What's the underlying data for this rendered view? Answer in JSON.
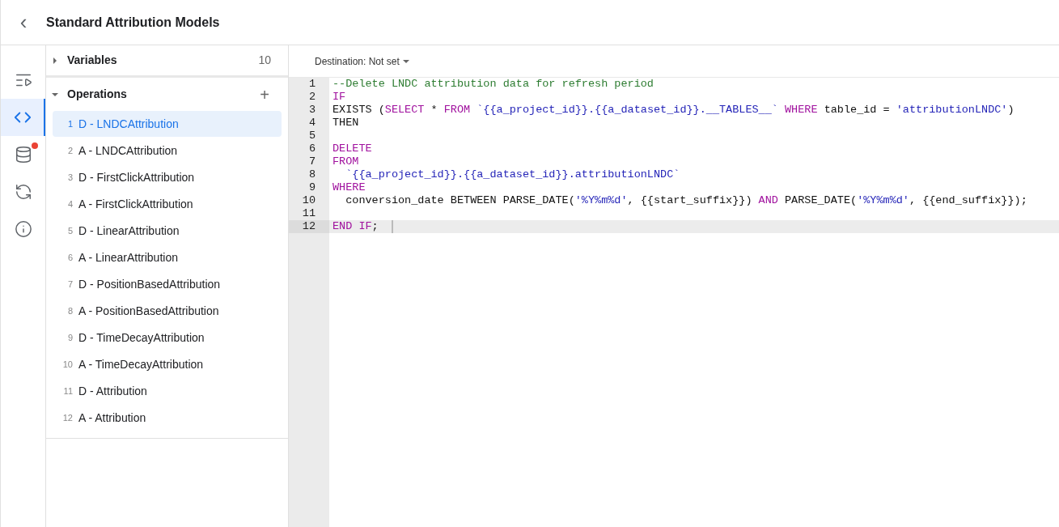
{
  "header": {
    "back": "‹",
    "title": "Standard Attribution Models"
  },
  "rail": [
    {
      "kind": "list",
      "selected": false,
      "badge": false
    },
    {
      "kind": "code",
      "selected": true,
      "badge": false
    },
    {
      "kind": "database",
      "selected": false,
      "badge": true
    },
    {
      "kind": "replay",
      "selected": false,
      "badge": false
    },
    {
      "kind": "info",
      "selected": false,
      "badge": false
    }
  ],
  "variables": {
    "label": "Variables",
    "count": "10",
    "expanded": false
  },
  "operations": {
    "label": "Operations",
    "add": "+",
    "expanded": true,
    "items": [
      {
        "number": "1",
        "label": "D - LNDCAttribution",
        "selected": true
      },
      {
        "number": "2",
        "label": "A - LNDCAttribution",
        "selected": false
      },
      {
        "number": "3",
        "label": "D - FirstClickAttribution",
        "selected": false
      },
      {
        "number": "4",
        "label": "A - FirstClickAttribution",
        "selected": false
      },
      {
        "number": "5",
        "label": "D - LinearAttribution",
        "selected": false
      },
      {
        "number": "6",
        "label": "A - LinearAttribution",
        "selected": false
      },
      {
        "number": "7",
        "label": "D - PositionBasedAttribution",
        "selected": false
      },
      {
        "number": "8",
        "label": "A - PositionBasedAttribution",
        "selected": false
      },
      {
        "number": "9",
        "label": "D - TimeDecayAttribution",
        "selected": false
      },
      {
        "number": "10",
        "label": "A - TimeDecayAttribution",
        "selected": false
      },
      {
        "number": "11",
        "label": "D - Attribution",
        "selected": false
      },
      {
        "number": "12",
        "label": "A - Attribution",
        "selected": false
      }
    ]
  },
  "destination": "Destination: Not set",
  "code_lines": [
    {
      "number": "1",
      "selected": false,
      "tokens": [
        {
          "kind": "comment",
          "text": "--Delete LNDC attribution data for refresh period"
        }
      ]
    },
    {
      "number": "2",
      "selected": false,
      "tokens": [
        {
          "kind": "keyword",
          "text": "IF"
        }
      ]
    },
    {
      "number": "3",
      "selected": false,
      "tokens": [
        {
          "kind": "plain",
          "text": "EXISTS ("
        },
        {
          "kind": "keyword",
          "text": "SELECT"
        },
        {
          "kind": "plain",
          "text": " * "
        },
        {
          "kind": "keyword",
          "text": "FROM "
        },
        {
          "kind": "string",
          "text": "`{{a_project_id}}.{{a_dataset_id}}.__TABLES__`"
        },
        {
          "kind": "keyword",
          "text": " WHERE"
        },
        {
          "kind": "plain",
          "text": " table_id = "
        },
        {
          "kind": "string",
          "text": "'attributionLNDC'"
        },
        {
          "kind": "plain",
          "text": ")"
        }
      ]
    },
    {
      "number": "4",
      "selected": false,
      "tokens": [
        {
          "kind": "plain",
          "text": "THEN"
        }
      ]
    },
    {
      "number": "5",
      "selected": false
    },
    {
      "number": "6",
      "selected": false,
      "tokens": [
        {
          "kind": "keyword",
          "text": "DELETE"
        }
      ]
    },
    {
      "number": "7",
      "selected": false,
      "tokens": [
        {
          "kind": "keyword",
          "text": "FROM"
        }
      ]
    },
    {
      "number": "8",
      "selected": false,
      "tokens": [
        {
          "kind": "string",
          "text": "  `{{a_project_id}}.{{a_dataset_id}}.attributionLNDC`"
        }
      ]
    },
    {
      "number": "9",
      "selected": false,
      "tokens": [
        {
          "kind": "keyword",
          "text": "WHERE"
        }
      ]
    },
    {
      "number": "10",
      "selected": false,
      "tokens": [
        {
          "kind": "plain",
          "text": "  conversion_date BETWEEN PARSE_DATE("
        },
        {
          "kind": "string",
          "text": "'%Y%m%d'"
        },
        {
          "kind": "plain",
          "text": ", {{start_suffix}}) "
        },
        {
          "kind": "keyword",
          "text": "AND"
        },
        {
          "kind": "plain",
          "text": " PARSE_DATE("
        },
        {
          "kind": "string",
          "text": "'%Y%m%d'"
        },
        {
          "kind": "plain",
          "text": ", {{end_suffix}});"
        }
      ]
    },
    {
      "number": "11",
      "selected": false
    },
    {
      "number": "12",
      "selected": true,
      "tokens": [
        {
          "kind": "keyword",
          "text": "END IF"
        },
        {
          "kind": "plain",
          "text": ";"
        }
      ]
    }
  ]
}
